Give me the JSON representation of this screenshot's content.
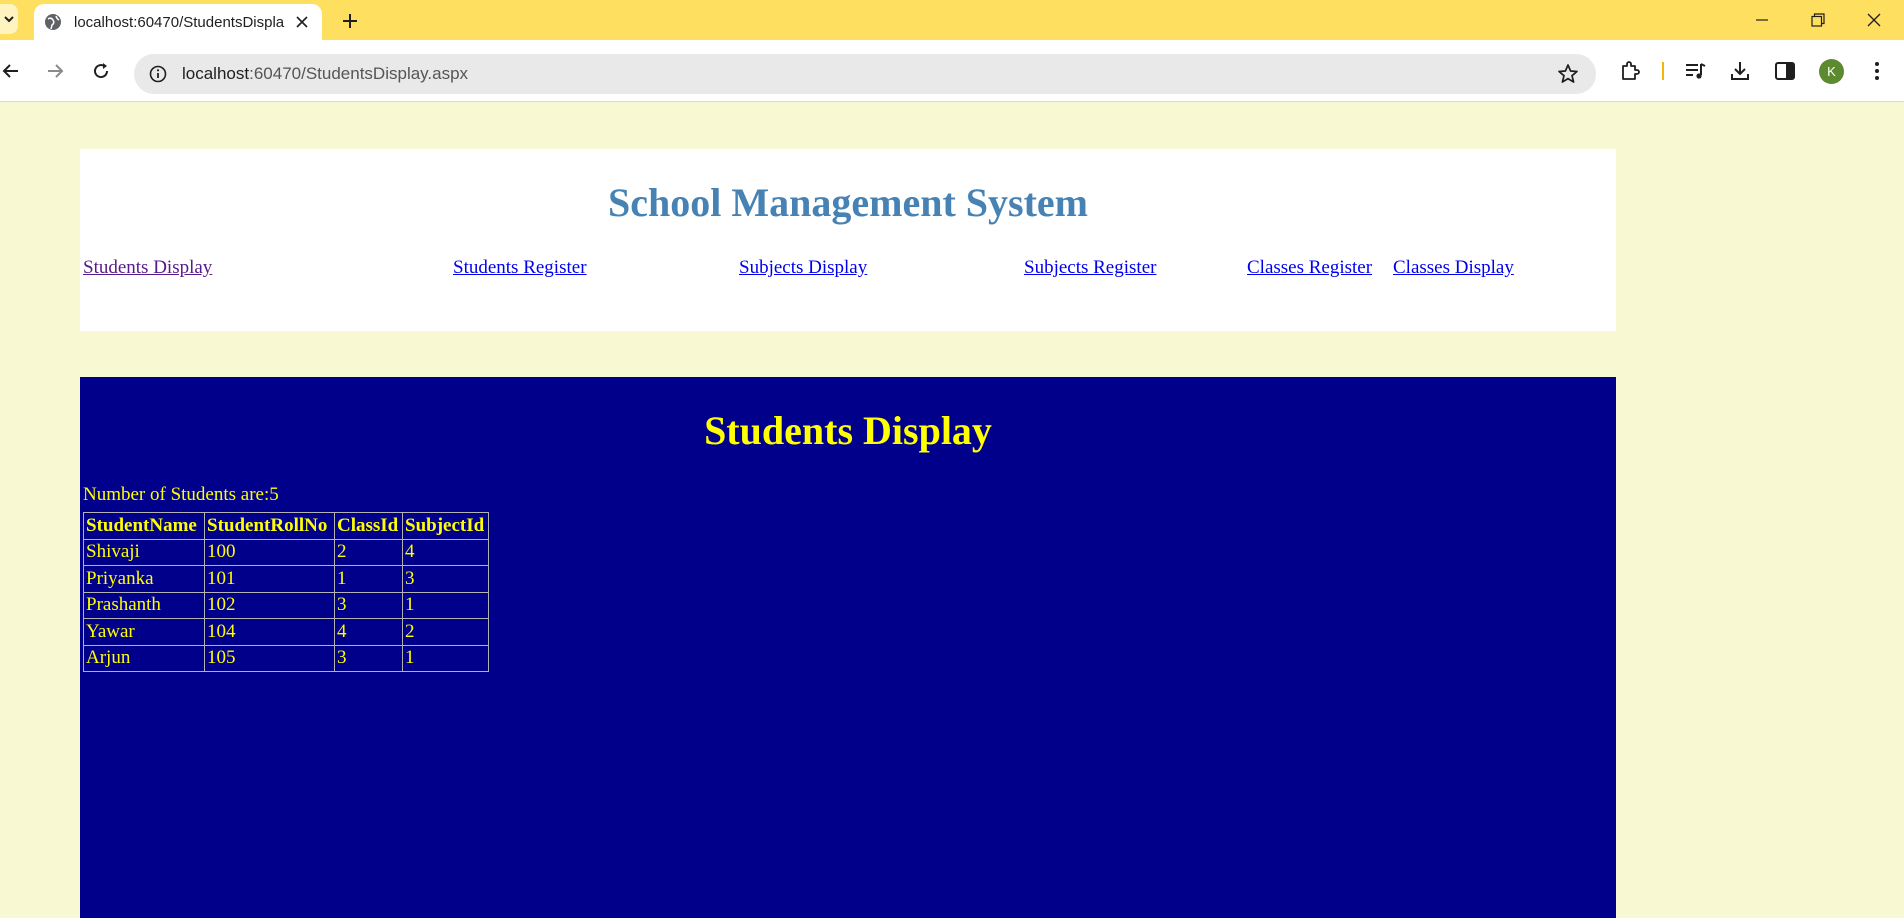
{
  "browser": {
    "tab_title": "localhost:60470/StudentsDispla",
    "url_host": "localhost",
    "url_path": ":60470/StudentsDisplay.aspx",
    "avatar_letter": "K",
    "accent_color": "#fedf5f"
  },
  "header": {
    "title": "School Management System",
    "nav_links": [
      "Students Display",
      "Students Register",
      "Subjects Display",
      "Subjects Register",
      "Classes Register",
      "Classes Display"
    ]
  },
  "main": {
    "title": "Students Display",
    "count_label": "Number of Students are:",
    "count_value": "5",
    "table": {
      "headers": [
        "StudentName",
        "StudentRollNo",
        "ClassId",
        "SubjectId"
      ],
      "rows": [
        [
          "Shivaji",
          "100",
          "2",
          "4"
        ],
        [
          "Priyanka",
          "101",
          "1",
          "3"
        ],
        [
          "Prashanth",
          "102",
          "3",
          "1"
        ],
        [
          "Yawar",
          "104",
          "4",
          "2"
        ],
        [
          "Arjun",
          "105",
          "3",
          "1"
        ]
      ]
    }
  },
  "colors": {
    "page_bg": "#f8f8d2",
    "header_title": "#4682b4",
    "main_bg": "#00008b",
    "main_text": "#ffff00"
  }
}
